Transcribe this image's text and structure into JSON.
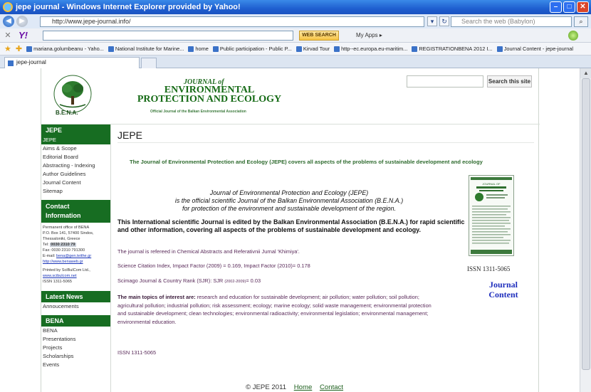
{
  "window": {
    "title": "jepe journal - Windows Internet Explorer provided by Yahoo!"
  },
  "browser": {
    "address": "http://www.jepe-journal.info/",
    "web_search_placeholder": "Search the web (Babylon)",
    "yahoo_search_button": "WEB SEARCH",
    "my_apps": "My Apps",
    "tab_label": "jepe-journal"
  },
  "favorites": [
    "mariana.golumbeanu - Yaho...",
    "National Institute for Marine...",
    "home",
    "Public participation - Public P...",
    "Kirvad Tour",
    "http--ec.europa.eu-maritim...",
    "REGISTRATIONBENA 2012 I...",
    "Journal Content - jepe-journal"
  ],
  "header": {
    "journal_of": "JOURNAL of",
    "title": "ENVIRONMENTAL PROTECTION AND ECOLOGY",
    "tagline": "Official Journal of the Balkan Environmental Association",
    "logo_text": "B.E.N.A.",
    "logo_ring": "Balkan Environmental Association",
    "search_button": "Search this site"
  },
  "sidebar": {
    "jepe_heading": "JEPE",
    "jepe_items": [
      "JEPE",
      "Aims & Scope",
      "Editorial Board",
      "Abstracting - Indexing",
      "Author Guidelines",
      "Journal Content",
      "Sitemap"
    ],
    "contact_heading": "Contact Information",
    "contact_lines": {
      "l1": "Permanent office of BENA",
      "l2": "P.O. Box 141, 57400 Sindos,",
      "l3": "Thessaloniki, Greece",
      "tel_label": "Tel:",
      "tel": "0030 2310 79",
      "fax": "Fax: 0030 2310 791300",
      "email_label": "E-mail:",
      "email": "bena@gen.teithe.gr",
      "website": "http://www.benaweb.gr",
      "printed_by": "Printed by SciBulCom Ltd.,",
      "printer_site": "www.scibulcom.net",
      "issn": "ISSN 1311-5065"
    },
    "news_heading": "Latest News",
    "news_items": [
      "Annoucements"
    ],
    "bena_heading": "BENA",
    "bena_items": [
      "BENA",
      "Presentations",
      "Projects",
      "Scholarships",
      "Events"
    ]
  },
  "main": {
    "title": "JEPE",
    "lead": "The Journal of Environmental Protection and Ecology (JEPE) covers all aspects of the problems of sustainable development and ecology",
    "intro_1": "Journal of Environmental Protection and Ecology (JEPE)",
    "intro_2": "is the official scientific Journal of the Balkan Environmental Association (B.E.N.A.)",
    "intro_3": "for protection of the environment and sustainable development of the region.",
    "bold_para": "This International scientific Journal is edited by the Balkan Environmental Association (B.E.N.A.) for rapid scientific and other information, covering all aspects of the problems of sustainable development and ecology.",
    "refereed": "The journal is refereed in Chemical Abstracts and Referativnii Jurnal 'Khimiya'.",
    "impact": "Science Citation Index, Impact Factor (2009) = 0.169,  Impact Factor (2010)= 0.178",
    "scimago_a": "Scimago Journal & Country Rank (SJR): SJR",
    "scimago_sub": "(2002-2009)",
    "scimago_b": "= 0.03",
    "topics_label": "The main topics of interest are:",
    "topics": " research and education for sustainable development; air pollution; water pollution; soil pollution; agricultural pollution; industrial pollution; risk assessment; ecology; marine ecology; solid waste management; environmental protection and sustainable development; clean technologies; environmental radioactivity; environmental legislation; environmental management; environmental education.",
    "issn": "ISSN 1311-5065",
    "issn_right": "ISSN 1311-5065",
    "journal_content_link": "Journal Content"
  },
  "footer": {
    "copyright": "© JEPE 2011",
    "home": "Home",
    "contact": "Contact"
  },
  "colors": {
    "brand_green": "#176d22",
    "title_bar": "#1f5fd0",
    "link_blue": "#1f2fbd"
  }
}
